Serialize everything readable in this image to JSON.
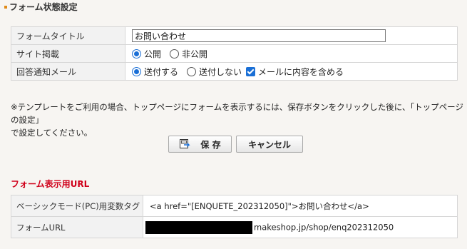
{
  "section_title": "フォーム状態設定",
  "form": {
    "title": {
      "label": "フォームタイトル",
      "value": "お問い合わせ"
    },
    "publish": {
      "label": "サイト掲載",
      "options": [
        {
          "label": "公開",
          "checked": true
        },
        {
          "label": "非公開",
          "checked": false
        }
      ]
    },
    "notify": {
      "label": "回答通知メール",
      "options": [
        {
          "label": "送付する",
          "checked": true
        },
        {
          "label": "送付しない",
          "checked": false
        }
      ],
      "include_content": {
        "label": "メールに内容を含める",
        "checked": true
      }
    }
  },
  "note": {
    "line1": "※テンプレートをご利用の場合、トップページにフォームを表示するには、保存ボタンをクリックした後に、「トップページの設定」",
    "line2": "で設定してください。"
  },
  "buttons": {
    "save": "保 存",
    "cancel": "キャンセル"
  },
  "url_section": {
    "title": "フォーム表示用URL",
    "rows": [
      {
        "label": "ベーシックモード(PC)用変数タグ",
        "value": "<a href=\"[ENQUETE_202312050]\">お問い合わせ</a>"
      },
      {
        "label": "フォームURL",
        "value": "makeshop.jp/shop/enq202312050"
      }
    ]
  },
  "colors": {
    "accent": "#e08a18",
    "url_title": "#d0001a",
    "control": "#1a6fd6"
  },
  "icons": {
    "save": "save-icon"
  }
}
